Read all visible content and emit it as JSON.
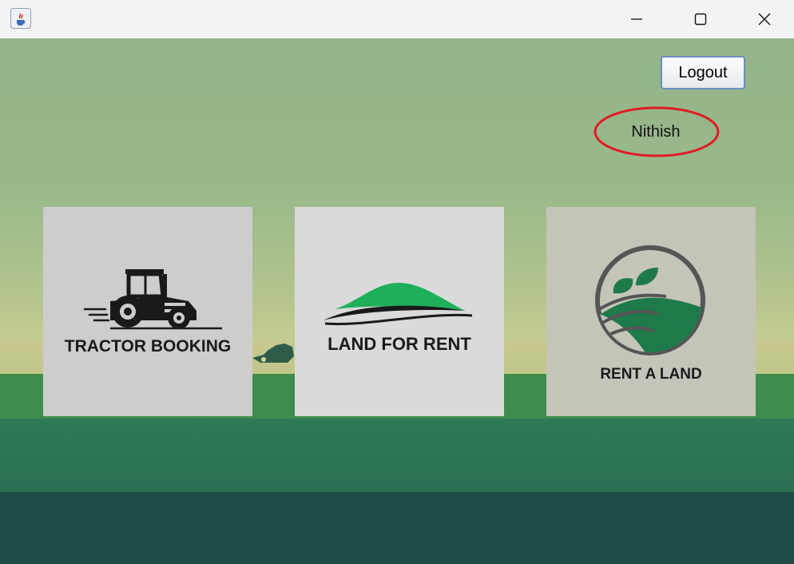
{
  "window": {
    "app_icon": "java-cup-icon",
    "controls": [
      "minimize-icon",
      "maximize-icon",
      "close-icon"
    ]
  },
  "header": {
    "logout_label": "Logout",
    "username": "Nithish",
    "highlight_color": "#e01b24"
  },
  "cards": [
    {
      "label": "TRACTOR BOOKING",
      "icon": "tractor-icon"
    },
    {
      "label": "LAND FOR RENT",
      "icon": "hill-icon"
    },
    {
      "label": "RENT A LAND",
      "icon": "field-leaf-icon",
      "accent": "#1e7a4a"
    }
  ],
  "colors": {
    "sky_top": "#93b48a",
    "ground": "#3f8c4c",
    "ground_dark": "#1e4e47",
    "hill_green": "#1faf5a"
  }
}
